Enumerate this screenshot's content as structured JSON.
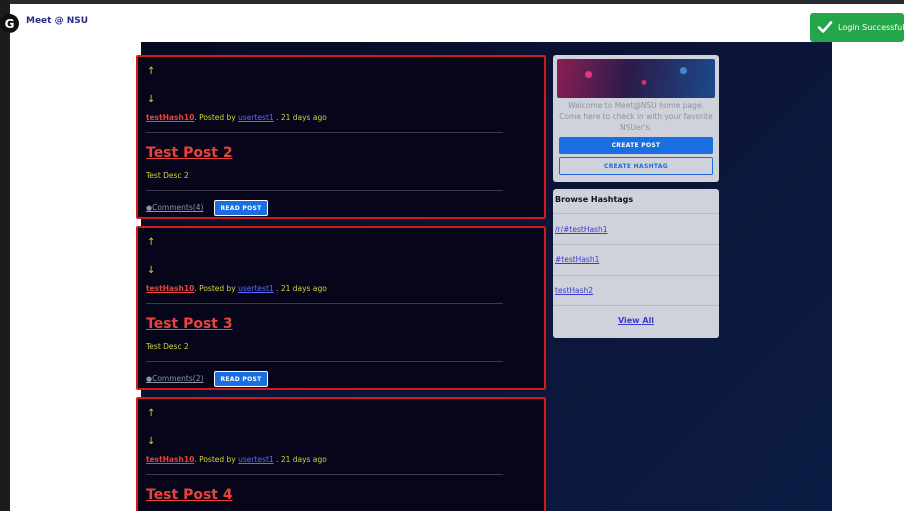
{
  "app": {
    "brand": "Meet @ NSU",
    "logo_letter": "G"
  },
  "toast": {
    "message": "Login Successful"
  },
  "posts": [
    {
      "upvote": "↑",
      "downvote": "↓",
      "hashtag": "testHash10",
      "posted_by_text": ". Posted by ",
      "user": "usertest1",
      "age": ". 21 days ago",
      "title": "Test Post 2",
      "description": "Test Desc 2",
      "comments": "Comments(4)",
      "read_label": "READ POST"
    },
    {
      "upvote": "↑",
      "downvote": "↓",
      "hashtag": "testHash10",
      "posted_by_text": ". Posted by ",
      "user": "usertest1",
      "age": ". 21 days ago",
      "title": "Test Post 3",
      "description": "Test Desc 2",
      "comments": "Comments(2)",
      "read_label": "READ POST"
    },
    {
      "upvote": "↑",
      "downvote": "↓",
      "hashtag": "testHash10",
      "posted_by_text": ". Posted by ",
      "user": "usertest1",
      "age": ". 21 days ago",
      "title": "Test Post 4",
      "description": "",
      "comments": "",
      "read_label": ""
    }
  ],
  "sidebar": {
    "welcome": "Welcome to Meet@NSU home page. Come here to check in with your favorite NSUer's.",
    "create_post": "CREATE POST",
    "create_hashtag": "CREATE HASHTAG"
  },
  "hashtags": {
    "title": "Browse Hashtags",
    "items": [
      "/r/#testHash1",
      "#testHash1",
      "testHash2"
    ],
    "view_all": "View All"
  }
}
